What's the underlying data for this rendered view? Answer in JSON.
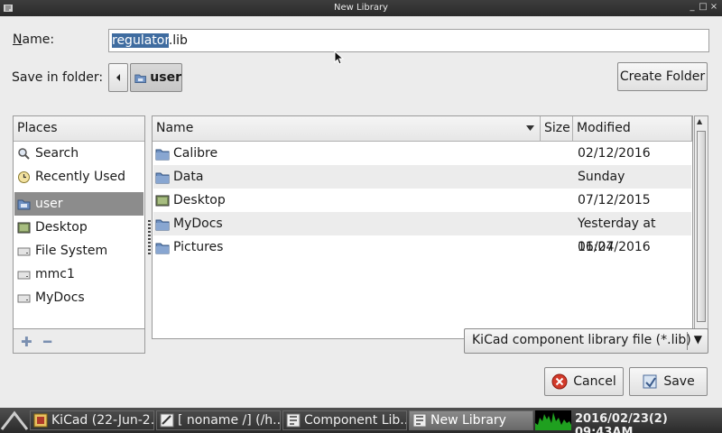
{
  "window": {
    "title": "New Library",
    "controls": [
      "_",
      "□",
      "×"
    ]
  },
  "dialog": {
    "name_label_prefix": "N",
    "name_label_rest": "ame:",
    "name_value_selected": "regulator",
    "name_value_rest": ".lib",
    "folder_label": "Save in folder:",
    "current_folder": "user",
    "create_folder_label": "Create Folder",
    "places_header": "Places",
    "places": [
      {
        "label": "Search",
        "icon": "search-icon"
      },
      {
        "label": "Recently Used",
        "icon": "recent-icon"
      },
      {
        "label": "user",
        "icon": "folder-home-icon",
        "selected": true
      },
      {
        "label": "Desktop",
        "icon": "desktop-icon"
      },
      {
        "label": "File System",
        "icon": "drive-icon"
      },
      {
        "label": "mmc1",
        "icon": "drive-icon"
      },
      {
        "label": "MyDocs",
        "icon": "drive-icon"
      }
    ],
    "columns": {
      "name": "Name",
      "size": "Size",
      "modified": "Modified"
    },
    "files": [
      {
        "name": "Calibre",
        "modified": "02/12/2016",
        "icon": "folder-icon"
      },
      {
        "name": "Data",
        "modified": "Sunday",
        "icon": "folder-icon"
      },
      {
        "name": "Desktop",
        "modified": "07/12/2015",
        "icon": "desktop-icon"
      },
      {
        "name": "MyDocs",
        "modified": "Yesterday at 16:27",
        "icon": "folder-icon"
      },
      {
        "name": "Pictures",
        "modified": "01/04/2016",
        "icon": "folder-icon"
      }
    ],
    "filter": "KiCad component library file (*.lib)",
    "cancel_label": "Cancel",
    "save_label": "Save"
  },
  "taskbar": {
    "tasks": [
      {
        "label": "KiCad (22-Jun-2..."
      },
      {
        "label": "[ noname /] (/h..."
      },
      {
        "label": "Component Lib..."
      },
      {
        "label": "New Library",
        "active": true
      }
    ],
    "clock": "2016/02/23(2) 09:43AM"
  }
}
